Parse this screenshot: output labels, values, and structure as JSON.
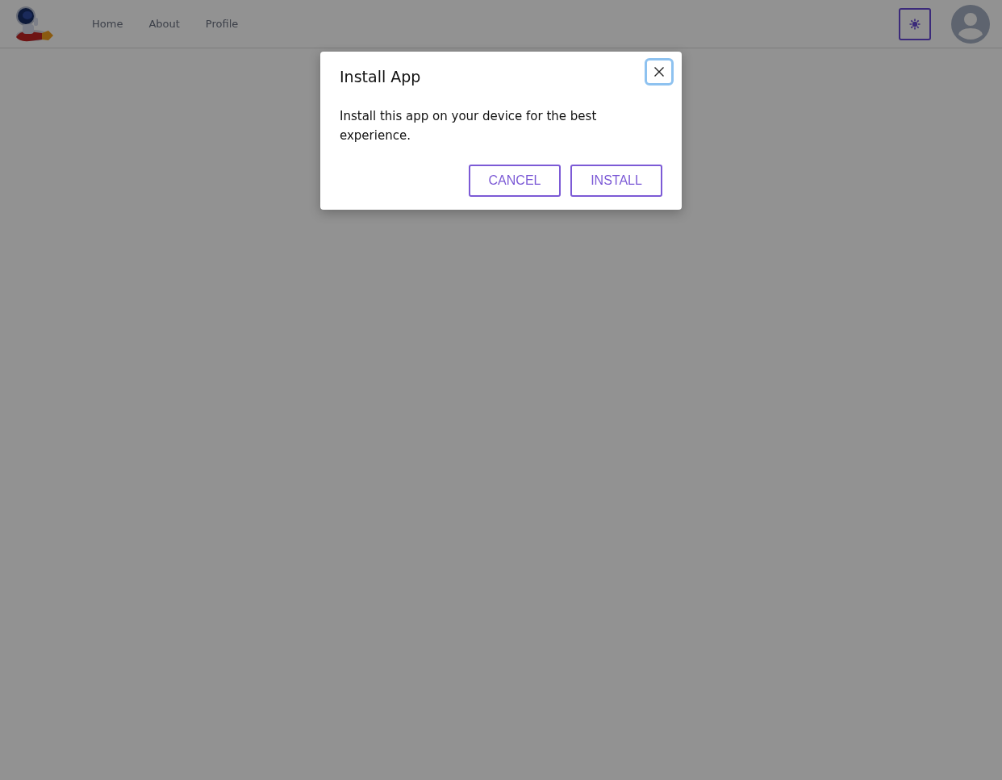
{
  "navbar": {
    "links": [
      {
        "label": "Home"
      },
      {
        "label": "About"
      },
      {
        "label": "Profile"
      }
    ]
  },
  "dialog": {
    "title": "Install App",
    "message": "Install this app on your device for the best experience.",
    "buttons": [
      {
        "label": "CANCEL"
      },
      {
        "label": "INSTALL"
      }
    ]
  }
}
